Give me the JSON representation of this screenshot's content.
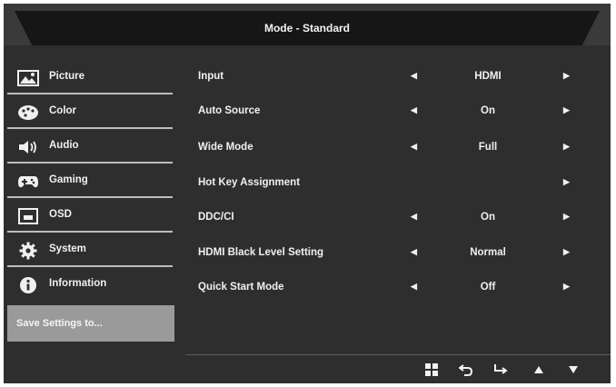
{
  "title": "Mode - Standard",
  "sidebar": {
    "items": [
      {
        "label": "Picture",
        "icon": "picture-icon"
      },
      {
        "label": "Color",
        "icon": "palette-icon"
      },
      {
        "label": "Audio",
        "icon": "speaker-icon"
      },
      {
        "label": "Gaming",
        "icon": "gamepad-icon"
      },
      {
        "label": "OSD",
        "icon": "osd-icon"
      },
      {
        "label": "System",
        "icon": "gear-icon"
      },
      {
        "label": "Information",
        "icon": "info-icon"
      }
    ],
    "save_label": "Save Settings to..."
  },
  "menu": {
    "rows": [
      {
        "label": "Input",
        "value": "HDMI"
      },
      {
        "label": "Auto Source",
        "value": "On"
      },
      {
        "label": "Wide Mode",
        "value": "Full"
      },
      {
        "label": "Hot Key Assignment",
        "value": ""
      },
      {
        "label": "DDC/CI",
        "value": "On"
      },
      {
        "label": "HDMI Black Level Setting",
        "value": "Normal"
      },
      {
        "label": "Quick Start Mode",
        "value": "Off"
      }
    ]
  },
  "nav_buttons": [
    "menu-icon",
    "back-icon",
    "enter-icon",
    "up-icon",
    "down-icon"
  ],
  "colors": {
    "background": "#2e2e2e",
    "title_banner": "#161616",
    "save_highlight": "#9a9a9a"
  }
}
